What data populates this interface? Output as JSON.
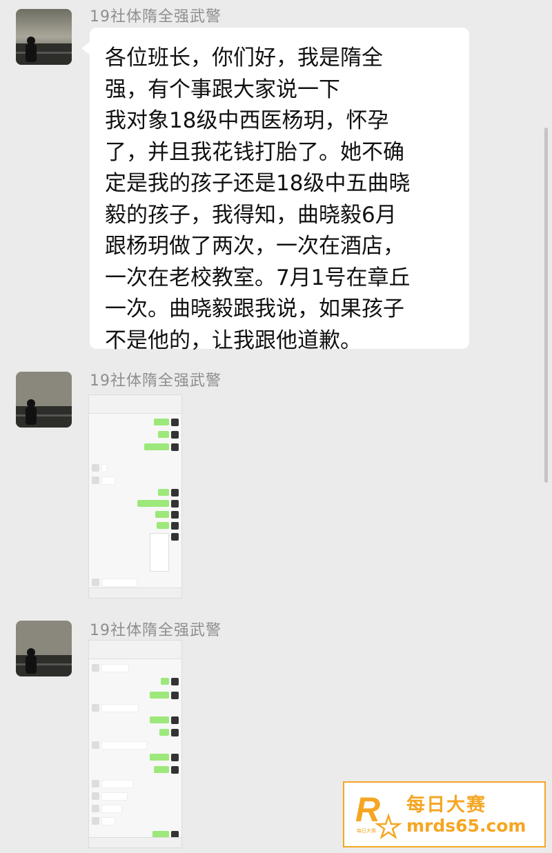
{
  "messages": [
    {
      "sender": "19社体隋全强武警",
      "text_lines": [
        "各位班长，你们好，我是隋全",
        "强，有个事跟大家说一下",
        "我对象18级中西医杨玥，怀孕",
        "了，并且我花钱打胎了。她不确",
        "定是我的孩子还是18级中五曲晓",
        "毅的孩子，我得知，曲晓毅6月",
        "跟杨玥做了两次，一次在酒店，",
        "一次在老校教室。7月1号在章丘",
        "一次。曲晓毅跟我说，如果孩子",
        "不是他的，让我跟他道歉。"
      ]
    },
    {
      "sender": "19社体隋全强武警",
      "image": "chat-screenshot-1"
    },
    {
      "sender": "19社体隋全强武警",
      "image": "chat-screenshot-2"
    }
  ],
  "watermark": {
    "logo_letter": "R",
    "logo_sub": "每日大赛",
    "name": "每日大赛",
    "url": "mrds65.com",
    "color": "#f5a623"
  }
}
